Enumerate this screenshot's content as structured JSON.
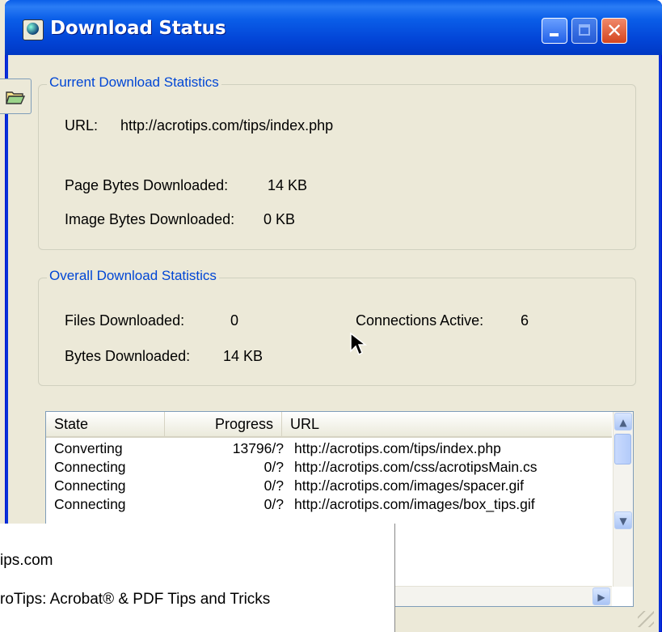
{
  "window": {
    "title": "Download Status",
    "icons": [
      "app-globe-icon",
      "minimize-icon",
      "maximize-icon",
      "close-icon"
    ]
  },
  "current_stats": {
    "legend": "Current Download Statistics",
    "url_label": "URL:",
    "url_value": "http://acrotips.com/tips/index.php",
    "page_bytes_label": "Page Bytes Downloaded:",
    "page_bytes_value": "14 KB",
    "image_bytes_label": "Image Bytes Downloaded:",
    "image_bytes_value": "0 KB"
  },
  "overall_stats": {
    "legend": "Overall Download Statistics",
    "files_label": "Files Downloaded:",
    "files_value": "0",
    "connections_label": "Connections Active:",
    "connections_value": "6",
    "bytes_label": "Bytes Downloaded:",
    "bytes_value": "14 KB"
  },
  "list": {
    "columns": [
      "State",
      "Progress",
      "URL"
    ],
    "rows": [
      {
        "state": "Converting",
        "progress": "13796/?",
        "url": "http://acrotips.com/tips/index.php"
      },
      {
        "state": "Connecting",
        "progress": "0/?",
        "url": "http://acrotips.com/css/acrotipsMain.cs"
      },
      {
        "state": "Connecting",
        "progress": "0/?",
        "url": "http://acrotips.com/images/spacer.gif"
      },
      {
        "state": "Connecting",
        "progress": "0/?",
        "url": "http://acrotips.com/images/box_tips.gif"
      }
    ]
  },
  "popup": {
    "line1": "ips.com",
    "line2": "roTips: Acrobat® & PDF Tips and Tricks"
  },
  "colors": {
    "titlebar": "#0a5ee8",
    "group_title": "#0046d5",
    "dialog_bg": "#ece9d8"
  }
}
